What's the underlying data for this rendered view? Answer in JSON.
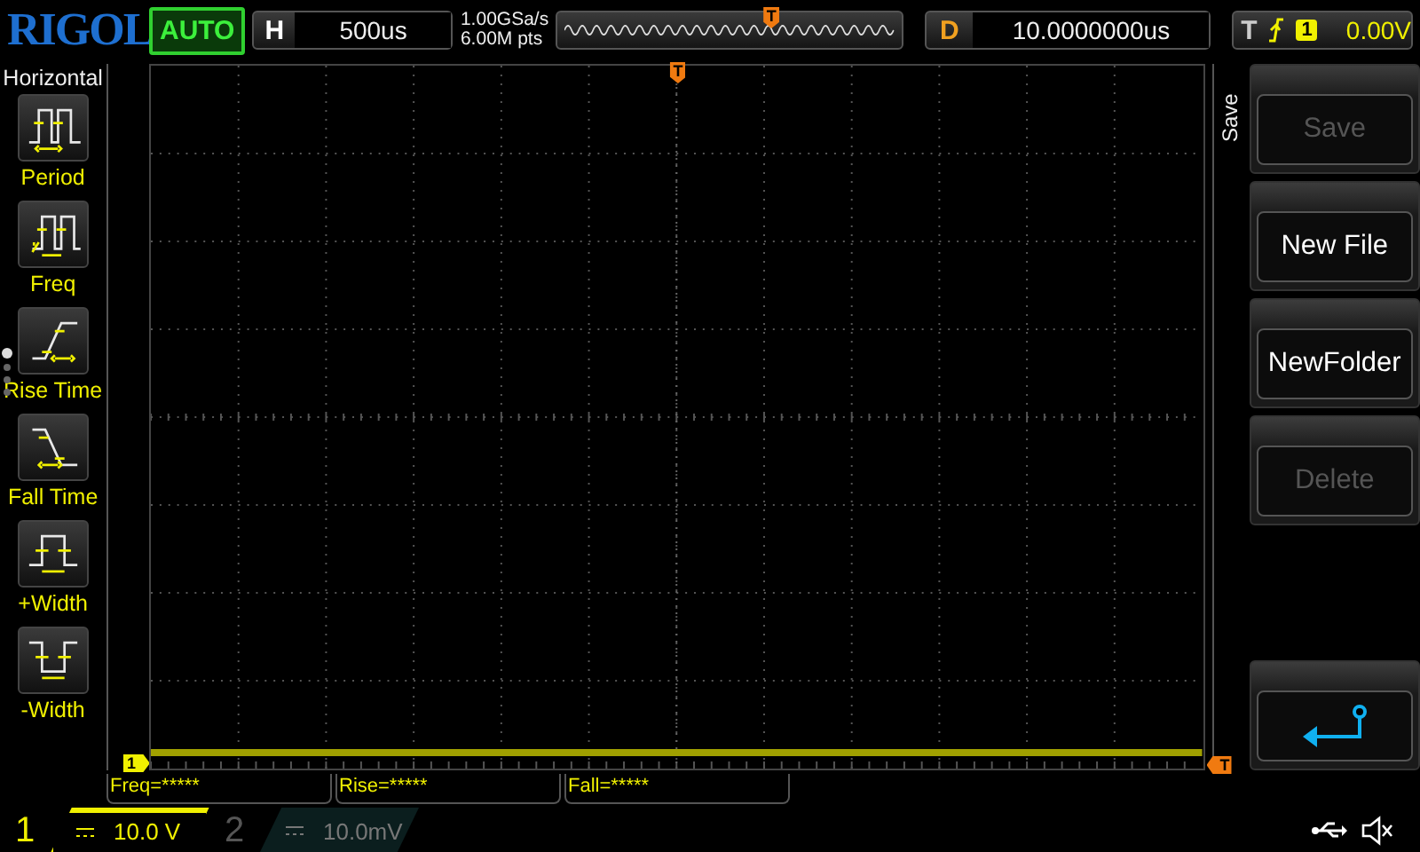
{
  "brand": "RIGOL",
  "run_state": "AUTO",
  "horizontal": {
    "label": "H",
    "timebase": "500us",
    "sample_rate": "1.00GSa/s",
    "memory_depth": "6.00M pts"
  },
  "memory_marker": "T",
  "delay": {
    "label": "D",
    "value": "10.0000000us"
  },
  "trigger": {
    "label": "T",
    "source": "1",
    "level": "0.00V"
  },
  "left_menu": {
    "title": "Horizontal",
    "items": [
      {
        "kind": "period",
        "label": "Period"
      },
      {
        "kind": "freq",
        "label": "Freq"
      },
      {
        "kind": "rise",
        "label": "Rise Time"
      },
      {
        "kind": "fall",
        "label": "Fall Time"
      },
      {
        "kind": "pwidth",
        "label": "+Width"
      },
      {
        "kind": "nwidth",
        "label": "-Width"
      }
    ],
    "pages": [
      {
        "selected": true
      },
      {
        "selected": false
      },
      {
        "selected": false
      },
      {
        "selected": false
      }
    ]
  },
  "plot": {
    "trigger_marker": "T",
    "channel_marker": "1",
    "level_marker": "T"
  },
  "right_menu": {
    "title": "Save",
    "buttons": [
      {
        "kind": "text",
        "label": "Save",
        "disabled": true
      },
      {
        "kind": "text",
        "label": "New File",
        "disabled": false
      },
      {
        "kind": "text",
        "label": "NewFolder",
        "disabled": false
      },
      {
        "kind": "text",
        "label": "Delete",
        "disabled": true
      },
      {
        "kind": "back"
      }
    ]
  },
  "measurements": [
    "Freq=*****",
    "Rise=*****",
    "Fall=*****"
  ],
  "channels": [
    {
      "number": "1",
      "scale": "10.0 V",
      "on": true
    },
    {
      "number": "2",
      "scale": "10.0mV",
      "on": false
    }
  ]
}
